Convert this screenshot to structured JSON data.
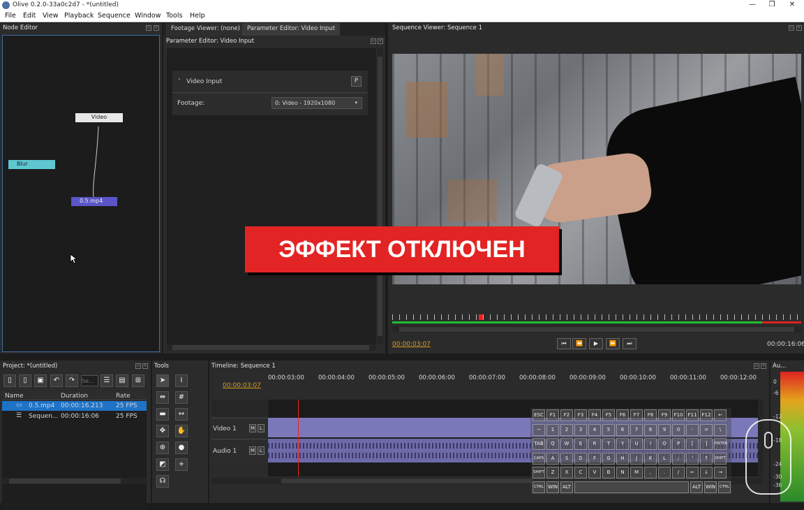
{
  "window": {
    "title": "Olive 0.2.0-33a0c2d7 - *(untitled)"
  },
  "menu": [
    "File",
    "Edit",
    "View",
    "Playback",
    "Sequence",
    "Window",
    "Tools",
    "Help"
  ],
  "node_editor": {
    "title": "Node Editor",
    "nodes": {
      "video": "Video",
      "blur": "Blur",
      "mp4": "0.5.mp4"
    }
  },
  "tabs": {
    "footage": "Footage Viewer: (none)",
    "param": "Parameter Editor: Video Input"
  },
  "param_editor": {
    "title": "Parameter Editor: Video Input",
    "section": "Video Input",
    "p_button": "P",
    "footage_label": "Footage:",
    "footage_value": "0: Video - 1920x1080"
  },
  "sequence_viewer": {
    "title": "Sequence Viewer: Sequence 1",
    "overlay": "ЭФФЕКТ ОТКЛЮЧЕН",
    "timecode": "00:00:03:07",
    "duration": "00:00:16:06"
  },
  "project": {
    "title": "Project: *(untitled)",
    "search_placeholder": "Se...",
    "columns": [
      "Name",
      "Duration",
      "Rate"
    ],
    "rows": [
      [
        "0.5.mp4",
        "00:00:16.213",
        "25 FPS"
      ],
      [
        "Sequen...",
        "00:00:16:06",
        "25 FPS"
      ]
    ]
  },
  "tools": {
    "title": "Tools"
  },
  "timeline": {
    "title": "Timeline: Sequence 1",
    "timecode": "00:00:03:07",
    "ticks": [
      "00:00:03:00",
      "00:00:04:00",
      "00:00:05:00",
      "00:00:06:00",
      "00:00:07:00",
      "00:00:08:00",
      "00:00:09:00",
      "00:00:10:00",
      "00:00:11:00",
      "00:00:12:00"
    ],
    "tracks": [
      {
        "name": "Video 1",
        "m": "M",
        "l": "L"
      },
      {
        "name": "Audio 1",
        "m": "M",
        "l": "L"
      }
    ]
  },
  "audio_monitor": {
    "title": "Au...",
    "levels": [
      "0",
      "-6",
      "-12",
      "-18",
      "-24",
      "-30",
      "-36"
    ]
  },
  "keyboard": {
    "rows": [
      [
        "ESC",
        "F1",
        "F2",
        "F3",
        "F4",
        "F5",
        "F6",
        "F7",
        "F8",
        "F9",
        "F10",
        "F11",
        "F12",
        "←"
      ],
      [
        "~",
        "1",
        "2",
        "3",
        "4",
        "5",
        "6",
        "7",
        "8",
        "9",
        "0",
        "-",
        "=",
        "\\"
      ],
      [
        "TAB",
        "Q",
        "W",
        "E",
        "R",
        "T",
        "Y",
        "U",
        "I",
        "O",
        "P",
        "[",
        "]",
        "ENTER"
      ],
      [
        "CAPS",
        "A",
        "S",
        "D",
        "F",
        "G",
        "H",
        "J",
        "K",
        "L",
        ";",
        "'",
        "↑",
        "SHIFT"
      ],
      [
        "SHIFT",
        "Z",
        "X",
        "C",
        "V",
        "B",
        "N",
        "M",
        ",",
        ".",
        "/",
        "←",
        "↓",
        "→"
      ],
      [
        "CTRL",
        "WIN",
        "ALT",
        "",
        "ALT",
        "WIN",
        "CTRL"
      ]
    ]
  }
}
